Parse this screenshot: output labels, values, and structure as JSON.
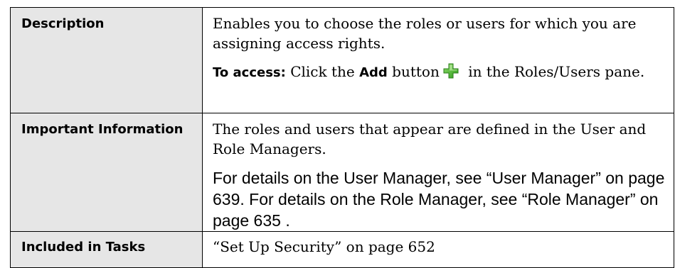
{
  "rows": [
    {
      "label": "Description",
      "text": "Enables you to choose the roles or users for which you are assigning access rights.",
      "access_prefix": "To access:",
      "access_click": " Click the ",
      "access_add": "Add",
      "access_button": " button",
      "access_suffix": " in the Roles/Users pane.",
      "icon": "add-plus-icon"
    },
    {
      "label": "Important Information",
      "text": "The roles and users that appear are defined in the User and Role Managers.",
      "details": "For details on the User Manager, see “User Manager” on page 639. For details on the Role Manager, see “Role Manager” on page 635 ."
    },
    {
      "label": "Included in Tasks",
      "text": "“Set Up Security” on page 652"
    }
  ],
  "colors": {
    "label_background": "#e6e6e6",
    "border": "#000000",
    "icon_green": "#3fae2a"
  }
}
